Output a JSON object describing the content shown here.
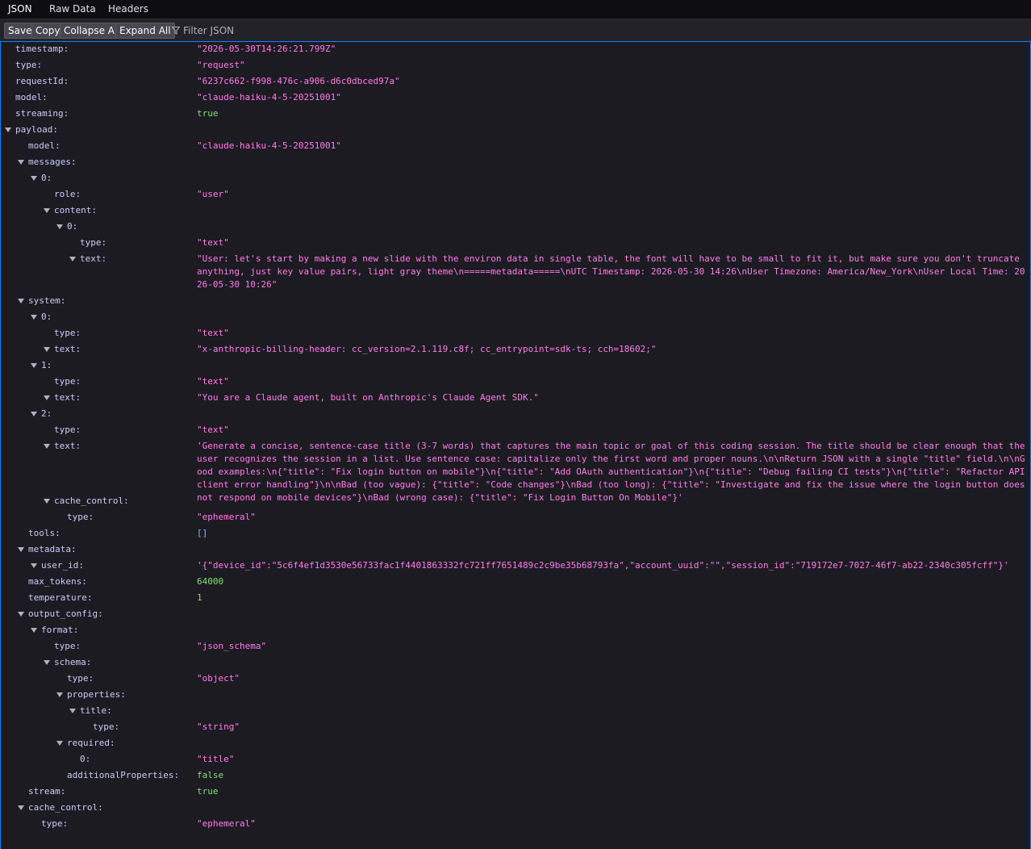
{
  "tabs": [
    "JSON",
    "Raw Data",
    "Headers"
  ],
  "toolbar": {
    "save": "Save",
    "copy": "Copy",
    "collapse_all": "Collapse All",
    "expand_all": "Expand All",
    "filter_placeholder": "Filter JSON",
    "filter_icon": "funnel-icon"
  },
  "rows": [
    {
      "k": "timestamp:",
      "v": "\"2026-05-30T14:26:21.799Z\""
    },
    {
      "k": "type:",
      "v": "\"request\""
    },
    {
      "k": "requestId:",
      "v": "\"6237c662-f998-476c-a906-d6c0dbced97a\""
    },
    {
      "k": "model:",
      "v": "\"claude-haiku-4-5-20251001\""
    },
    {
      "k": "streaming:",
      "v": "true"
    },
    {
      "k": "payload:"
    },
    {
      "k": "model:",
      "v": "\"claude-haiku-4-5-20251001\""
    },
    {
      "k": "messages:"
    },
    {
      "k": "0:"
    },
    {
      "k": "role:",
      "v": "\"user\""
    },
    {
      "k": "content:"
    },
    {
      "k": "0:"
    },
    {
      "k": "type:",
      "v": "\"text\""
    },
    {
      "k": "text:",
      "v": "\"User: let's start by making a new slide with the environ data in single table, the font will have to be small to fit it, but make sure you don't truncate anything, just key value pairs, light gray theme\\n=====metadata=====\\nUTC Timestamp: 2026-05-30 14:26\\nUser Timezone: America/New_York\\nUser Local Time: 2026-05-30 10:26\""
    },
    {
      "k": "system:"
    },
    {
      "k": "0:"
    },
    {
      "k": "type:",
      "v": "\"text\""
    },
    {
      "k": "text:",
      "v": "\"x-anthropic-billing-header: cc_version=2.1.119.c8f; cc_entrypoint=sdk-ts; cch=18602;\""
    },
    {
      "k": "1:"
    },
    {
      "k": "type:",
      "v": "\"text\""
    },
    {
      "k": "text:",
      "v": "\"You are a Claude agent, built on Anthropic's Claude Agent SDK.\""
    },
    {
      "k": "2:"
    },
    {
      "k": "type:",
      "v": "\"text\""
    },
    {
      "k": "text:",
      "v": "'Generate a concise, sentence-case title (3-7 words) that captures the main topic or goal of this coding session. The title should be clear enough that the user recognizes the session in a list. Use sentence case: capitalize only the first word and proper nouns.\\n\\nReturn JSON with a single \"title\" field.\\n\\nGood examples:\\n{\"title\": \"Fix login button on mobile\"}\\n{\"title\": \"Add OAuth authentication\"}\\n{\"title\": \"Debug failing CI tests\"}\\n{\"title\": \"Refactor API client error handling\"}\\n\\nBad (too vague): {\"title\": \"Code changes\"}\\nBad (too long): {\"title\": \"Investigate and fix the issue where the login button does not respond on mobile devices\"}\\nBad (wrong case): {\"title\": \"Fix Login Button On Mobile\"}'"
    },
    {
      "k": "cache_control:"
    },
    {
      "k": "type:",
      "v": "\"ephemeral\""
    },
    {
      "k": "tools:",
      "v": "[]"
    },
    {
      "k": "metadata:"
    },
    {
      "k": "user_id:",
      "v": "'{\"device_id\":\"5c6f4ef1d3530e56733fac1f4401863332fc721ff7651489c2c9be35b68793fa\",\"account_uuid\":\"\",\"session_id\":\"719172e7-7027-46f7-ab22-2340c305fcff\"}'"
    },
    {
      "k": "max_tokens:",
      "v": "64000"
    },
    {
      "k": "temperature:",
      "v": "1"
    },
    {
      "k": "output_config:"
    },
    {
      "k": "format:"
    },
    {
      "k": "type:",
      "v": "\"json_schema\""
    },
    {
      "k": "schema:"
    },
    {
      "k": "type:",
      "v": "\"object\""
    },
    {
      "k": "properties:"
    },
    {
      "k": "title:"
    },
    {
      "k": "type:",
      "v": "\"string\""
    },
    {
      "k": "required:"
    },
    {
      "k": "0:",
      "v": "\"title\""
    },
    {
      "k": "additionalProperties:",
      "v": "false"
    },
    {
      "k": "stream:",
      "v": "true"
    },
    {
      "k": "cache_control:"
    },
    {
      "k": "type:",
      "v": "\"ephemeral\""
    }
  ]
}
